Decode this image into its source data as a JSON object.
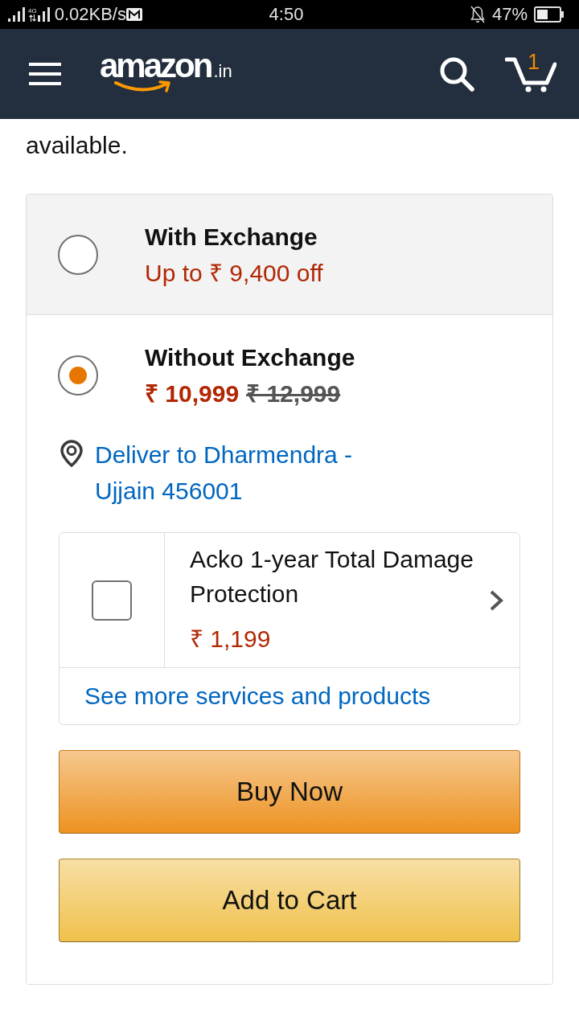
{
  "status_bar": {
    "network_type": "4G",
    "network_speed": "0.02KB/s",
    "time": "4:50",
    "battery": "47%"
  },
  "header": {
    "logo_text": "amazon",
    "logo_suffix": ".in",
    "cart_count": "1"
  },
  "intro_text": "available.",
  "purchase_options": [
    {
      "kind": "exchange",
      "title": "With Exchange",
      "offer": "Up to ₹ 9,400 off",
      "selected": false
    },
    {
      "kind": "price",
      "title": "Without Exchange",
      "price": "₹ 10,999",
      "list_price": "₹ 12,999",
      "selected": true,
      "details": {
        "delivery": "Deliver to Dharmendra - Ujjain 456001",
        "protection_plan": {
          "title": "Acko 1-year Total Damage Protection",
          "price": "₹ 1,199",
          "checked": false
        },
        "see_more": "See more services and products",
        "buttons": [
          {
            "kind": "buy",
            "label": "Buy Now"
          },
          {
            "kind": "cart",
            "label": "Add to Cart"
          }
        ]
      }
    }
  ]
}
